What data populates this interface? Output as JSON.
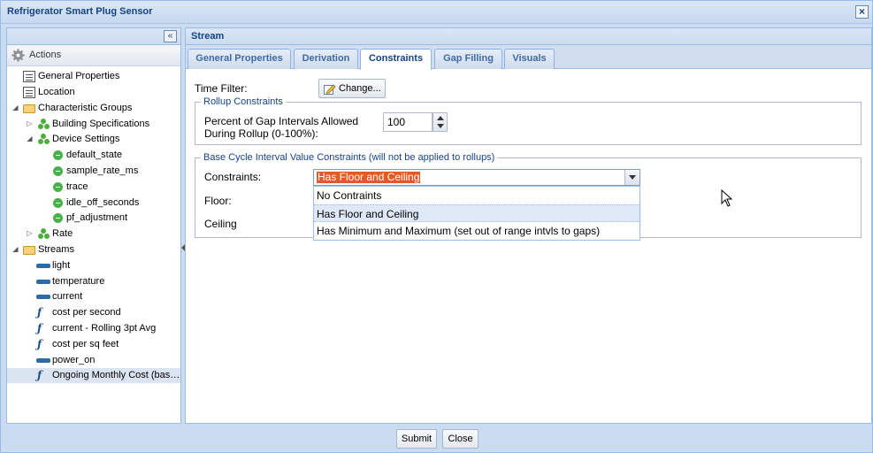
{
  "window": {
    "title": "Refrigerator Smart Plug Sensor"
  },
  "left": {
    "actions_label": "Actions",
    "tree": [
      {
        "label": "General Properties",
        "icon": "page-icon"
      },
      {
        "label": "Location",
        "icon": "page-icon"
      },
      {
        "label": "Characteristic Groups",
        "icon": "folder-icon"
      },
      {
        "label": "Building Specifications",
        "icon": "group-icon"
      },
      {
        "label": "Device Settings",
        "icon": "group-icon"
      },
      {
        "label": "default_state",
        "icon": "setting-icon"
      },
      {
        "label": "sample_rate_ms",
        "icon": "setting-icon"
      },
      {
        "label": "trace",
        "icon": "setting-icon"
      },
      {
        "label": "idle_off_seconds",
        "icon": "setting-icon"
      },
      {
        "label": "pf_adjustment",
        "icon": "setting-icon"
      },
      {
        "label": "Rate",
        "icon": "group-icon"
      },
      {
        "label": "Streams",
        "icon": "folder-icon"
      },
      {
        "label": "light",
        "icon": "stream-icon"
      },
      {
        "label": "temperature",
        "icon": "stream-icon"
      },
      {
        "label": "current",
        "icon": "stream-icon"
      },
      {
        "label": "cost per second",
        "icon": "function-icon"
      },
      {
        "label": "current - Rolling 3pt Avg",
        "icon": "function-icon"
      },
      {
        "label": "cost per sq feet",
        "icon": "function-icon"
      },
      {
        "label": "power_on",
        "icon": "stream-icon"
      },
      {
        "label": "Ongoing Monthly Cost (bas…",
        "icon": "function-icon"
      }
    ]
  },
  "right": {
    "title": "Stream",
    "tabs": [
      "General Properties",
      "Derivation",
      "Constraints",
      "Gap Filling",
      "Visuals"
    ],
    "active_tab": "Constraints",
    "time_filter_label": "Time Filter:",
    "change_button": "Change...",
    "rollup": {
      "legend": "Rollup Constraints",
      "gap_label_line1": "Percent of Gap Intervals Allowed",
      "gap_label_line2": "During Rollup (0-100%):",
      "gap_value": "100"
    },
    "base": {
      "legend": "Base Cycle Interval Value Constraints (will not be applied to rollups)",
      "constraints_label": "Constraints:",
      "floor_label": "Floor:",
      "ceiling_label": "Ceiling",
      "selected": "Has Floor and Ceiling",
      "options": [
        "No Contraints",
        "Has Floor and Ceiling",
        "Has Minimum and Maximum (set out of range intvls to gaps)"
      ]
    }
  },
  "footer": {
    "submit": "Submit",
    "close": "Close"
  }
}
